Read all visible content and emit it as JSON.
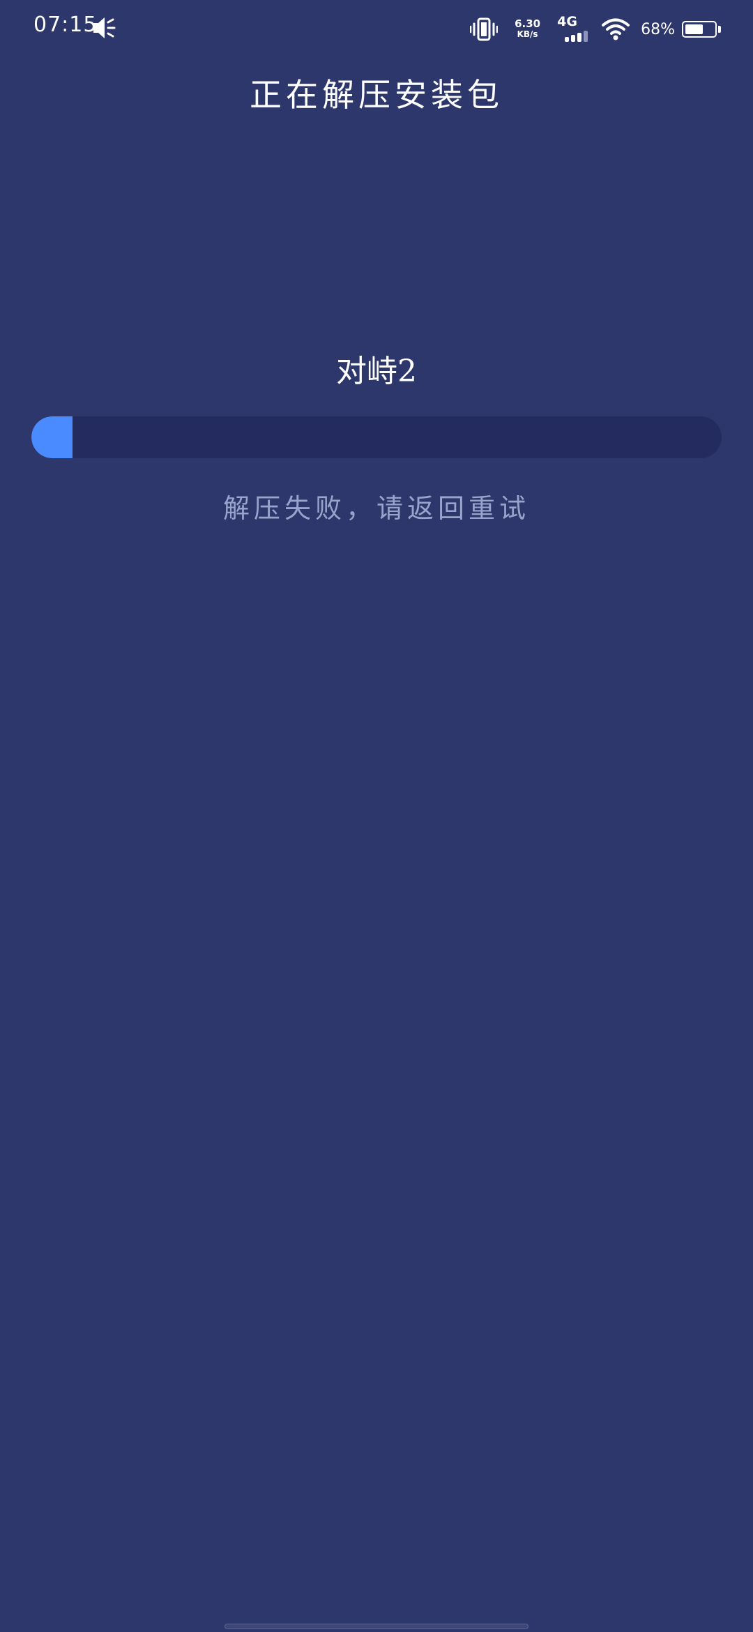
{
  "status_bar": {
    "time": "07:15",
    "net_speed_value": "6.30",
    "net_speed_unit": "KB/s",
    "network_type": "4G",
    "battery_percent_text": "68%",
    "battery_level": 0.68,
    "icons": [
      "speaker-icon",
      "vibrate-icon",
      "cellular-signal-icon",
      "wifi-icon",
      "battery-icon"
    ]
  },
  "page": {
    "title": "正在解压安装包",
    "app_name": "对峙2",
    "progress_fraction": 0.06,
    "message": "解压失败，请返回重试"
  },
  "colors": {
    "background": "#2e376b",
    "track": "#242c5f",
    "accent": "#4a8cff",
    "message_text": "#9aa3cb"
  }
}
